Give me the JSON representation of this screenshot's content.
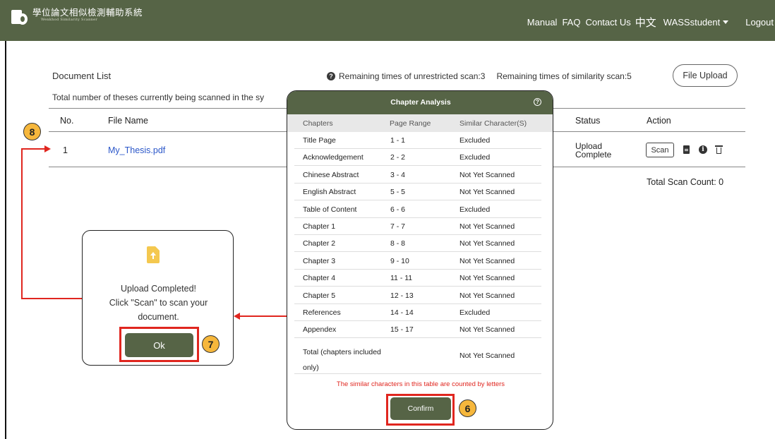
{
  "header": {
    "title_zh": "學位論文相似檢測輔助系統",
    "title_en": "Wenkhod Similarity Scanner",
    "nav": {
      "manual": "Manual",
      "faq": "FAQ",
      "contact": "Contact Us",
      "lang": "中文",
      "user": "WASSstudent",
      "logout": "Logout"
    }
  },
  "doc": {
    "title": "Document List",
    "remaining_unrestricted": "Remaining times of unrestricted scan:3",
    "remaining_similarity": "Remaining times of similarity scan:5",
    "file_upload": "File Upload",
    "total_scanning": "Total number of theses currently being scanned in the sy",
    "columns": {
      "no": "No.",
      "file": "File Name",
      "status": "Status",
      "action": "Action"
    },
    "row": {
      "no": "1",
      "file": "My_Thesis.pdf",
      "status_line1": "Upload",
      "status_line2": "Complete",
      "scan": "Scan"
    },
    "total_scan_count": "Total Scan Count: 0"
  },
  "steps": {
    "s6": "6",
    "s7": "7",
    "s8": "8"
  },
  "upload_dialog": {
    "line1": "Upload Completed!",
    "line2": "Click \"Scan\" to scan your",
    "line3": "document.",
    "ok": "Ok"
  },
  "chapter_modal": {
    "title": "Chapter Analysis",
    "help": "?",
    "columns": {
      "chapters": "Chapters",
      "range": "Page Range",
      "similar": "Similar Character(S)"
    },
    "rows": [
      {
        "chapter": "Title Page",
        "range": "1 - 1",
        "similar": "Excluded"
      },
      {
        "chapter": "Acknowledgement",
        "range": "2 - 2",
        "similar": "Excluded"
      },
      {
        "chapter": "Chinese Abstract",
        "range": "3 - 4",
        "similar": "Not Yet Scanned"
      },
      {
        "chapter": "English Abstract",
        "range": "5 - 5",
        "similar": "Not Yet Scanned"
      },
      {
        "chapter": "Table of Content",
        "range": "6 - 6",
        "similar": "Excluded"
      },
      {
        "chapter": "Chapter 1",
        "range": "7 - 7",
        "similar": "Not Yet Scanned"
      },
      {
        "chapter": "Chapter 2",
        "range": "8 - 8",
        "similar": "Not Yet Scanned"
      },
      {
        "chapter": "Chapter 3",
        "range": "9 - 10",
        "similar": "Not Yet Scanned"
      },
      {
        "chapter": "Chapter 4",
        "range": "11 - 11",
        "similar": "Not Yet Scanned"
      },
      {
        "chapter": "Chapter 5",
        "range": "12 - 13",
        "similar": "Not Yet Scanned"
      },
      {
        "chapter": "References",
        "range": "14 - 14",
        "similar": "Excluded"
      },
      {
        "chapter": "Appendex",
        "range": "15 - 17",
        "similar": "Not Yet Scanned"
      }
    ],
    "total_label_1": "Total (chapters included",
    "total_label_2": "only)",
    "total_value": "Not Yet Scanned",
    "note": "The similar characters in this table are counted by letters",
    "confirm": "Confirm"
  }
}
